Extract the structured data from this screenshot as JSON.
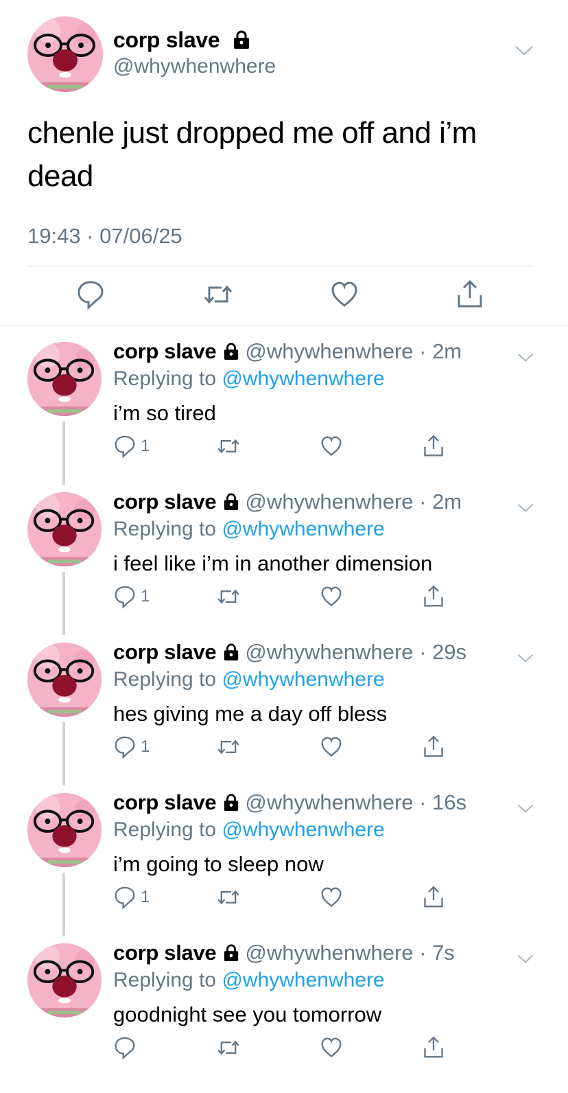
{
  "main_tweet": {
    "display_name": "corp slave",
    "handle": "@whywhenwhere",
    "text": "chenle just dropped me off and i’m dead",
    "timestamp": "19:43 · 07/06/25"
  },
  "replies": [
    {
      "display_name": "corp slave",
      "handle": "@whywhenwhere · 2m",
      "replying_prefix": "Replying to ",
      "replying_to": "@whywhenwhere",
      "text": "i’m so tired",
      "reply_count": "1"
    },
    {
      "display_name": "corp slave",
      "handle": "@whywhenwhere · 2m",
      "replying_prefix": "Replying to ",
      "replying_to": "@whywhenwhere",
      "text": "i feel like i’m in another dimension",
      "reply_count": "1"
    },
    {
      "display_name": "corp slave",
      "handle": "@whywhenwhere · 29s",
      "replying_prefix": "Replying to ",
      "replying_to": "@whywhenwhere",
      "text": "hes giving me a day off bless",
      "reply_count": "1"
    },
    {
      "display_name": "corp slave",
      "handle": "@whywhenwhere · 16s",
      "replying_prefix": "Replying to ",
      "replying_to": "@whywhenwhere",
      "text": "i’m going to sleep now",
      "reply_count": "1"
    },
    {
      "display_name": "corp slave",
      "handle": "@whywhenwhere · 7s",
      "replying_prefix": "Replying to ",
      "replying_to": "@whywhenwhere",
      "text": "goodnight see you tomorrow",
      "reply_count": ""
    }
  ],
  "colors": {
    "link": "#1da1f2",
    "secondary_text": "#657786",
    "divider": "#d6dbe0",
    "icon": "#657786"
  },
  "icons": [
    "lock-icon",
    "chevron-down-icon",
    "reply-icon",
    "retweet-icon",
    "like-icon",
    "share-icon"
  ]
}
